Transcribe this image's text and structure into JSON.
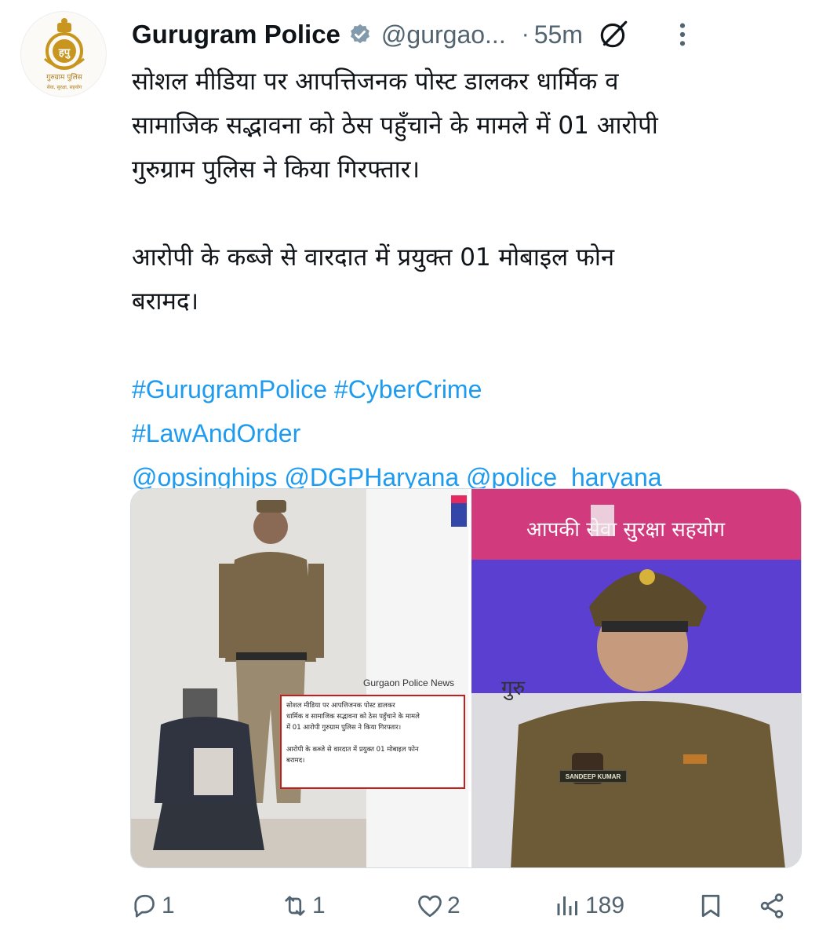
{
  "post": {
    "author": {
      "display_name": "Gurugram Police",
      "handle": "@gurgao...",
      "verified": true,
      "avatar_icon": "haryana-police-emblem-icon",
      "avatar_text_top": "हपु",
      "avatar_text_mid": "गुरुग्राम पुलिस",
      "avatar_text_bottom": "सेवा, सुरक्षा, सहयोग"
    },
    "separator": "·",
    "time": "55m",
    "body_lines": [
      "सोशल मीडिया पर आपत्तिजनक पोस्ट डालकर धार्मिक व",
      "सामाजिक सद्भावना को ठेस पहुँचाने के मामले में 01 आरोपी",
      "गुरुग्राम पुलिस ने किया गिरफ्तार।",
      "आरोपी के कब्जे से वारदात में प्रयुक्त 01 मोबाइल फोन",
      "बरामद।"
    ],
    "hashtags_line1": "#GurugramPolice #CyberCrime",
    "hashtags_line2": "#LawAndOrder",
    "mentions_line": "@opsinghips @DGPHaryana @police_haryana",
    "media": {
      "left": {
        "news_label": "Gurgaon Police News",
        "overlay_lines": [
          "सोशल मीडिया पर आपत्तिजनक पोस्ट डालकर",
          "धार्मिक व सामाजिक सद्भावना को ठेस पहुँचाने के मामले",
          "में 01 आरोपी गुरुग्राम पुलिस ने किया गिरफ्तार।",
          "",
          "आरोपी के कब्जे से वारदात में प्रयुक्त 01 मोबाइल फोन",
          "बरामद।"
        ]
      },
      "right": {
        "banner_text": "आपकी सेवा सुरक्षा सहयोग",
        "side_text": "गुरु",
        "name_tag": "SANDEEP KUMAR"
      }
    },
    "actions": {
      "replies": "1",
      "reposts": "1",
      "likes": "2",
      "views": "189"
    },
    "colors": {
      "link": "#1d9bf0",
      "verified": "#829aab",
      "muted": "#536471"
    }
  }
}
